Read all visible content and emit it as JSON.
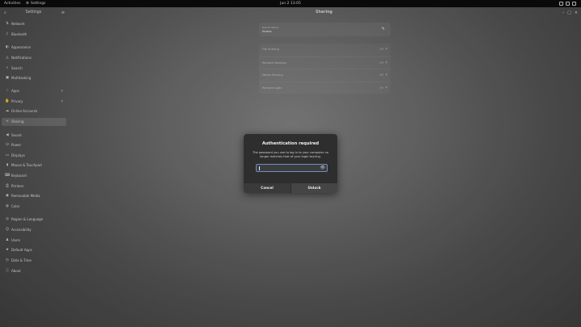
{
  "topbar": {
    "activities": "Activities",
    "app_name": "Settings",
    "clock": "Jun 2  13:05"
  },
  "window": {
    "left_title": "Settings",
    "main_title": "Sharing"
  },
  "sidebar": {
    "items": [
      {
        "label": "Network",
        "icon": "network-icon"
      },
      {
        "label": "Bluetooth",
        "icon": "bluetooth-icon"
      },
      {
        "label": "Appearance",
        "icon": "appearance-icon"
      },
      {
        "label": "Notifications",
        "icon": "bell-icon"
      },
      {
        "label": "Search",
        "icon": "search-icon"
      },
      {
        "label": "Multitasking",
        "icon": "multitasking-icon"
      },
      {
        "label": "Apps",
        "icon": "apps-icon"
      },
      {
        "label": "Privacy",
        "icon": "hand-icon"
      },
      {
        "label": "Online Accounts",
        "icon": "cloud-icon"
      },
      {
        "label": "Sharing",
        "icon": "share-icon"
      },
      {
        "label": "Sound",
        "icon": "speaker-icon"
      },
      {
        "label": "Power",
        "icon": "power-icon"
      },
      {
        "label": "Displays",
        "icon": "display-icon"
      },
      {
        "label": "Mouse & Touchpad",
        "icon": "mouse-icon"
      },
      {
        "label": "Keyboard",
        "icon": "keyboard-icon"
      },
      {
        "label": "Printers",
        "icon": "printer-icon"
      },
      {
        "label": "Removable Media",
        "icon": "media-icon"
      },
      {
        "label": "Color",
        "icon": "color-icon"
      },
      {
        "label": "Region & Language",
        "icon": "globe-icon"
      },
      {
        "label": "Accessibility",
        "icon": "accessibility-icon"
      },
      {
        "label": "Users",
        "icon": "users-icon"
      },
      {
        "label": "Default Apps",
        "icon": "star-icon"
      },
      {
        "label": "Date & Time",
        "icon": "clock-icon"
      },
      {
        "label": "About",
        "icon": "info-icon"
      }
    ]
  },
  "sharing": {
    "device_name_label": "Device Name",
    "device_name_value": "fedora",
    "rows": [
      {
        "label": "File Sharing",
        "status": "Off"
      },
      {
        "label": "Remote Desktop",
        "status": "Off"
      },
      {
        "label": "Media Sharing",
        "status": "Off"
      },
      {
        "label": "Remote Login",
        "status": "Off"
      }
    ]
  },
  "dialog": {
    "title": "Authentication required",
    "message": "The password you use to log in to your computer no longer matches that of your login keyring.",
    "password_value": "",
    "cancel_label": "Cancel",
    "unlock_label": "Unlock"
  }
}
